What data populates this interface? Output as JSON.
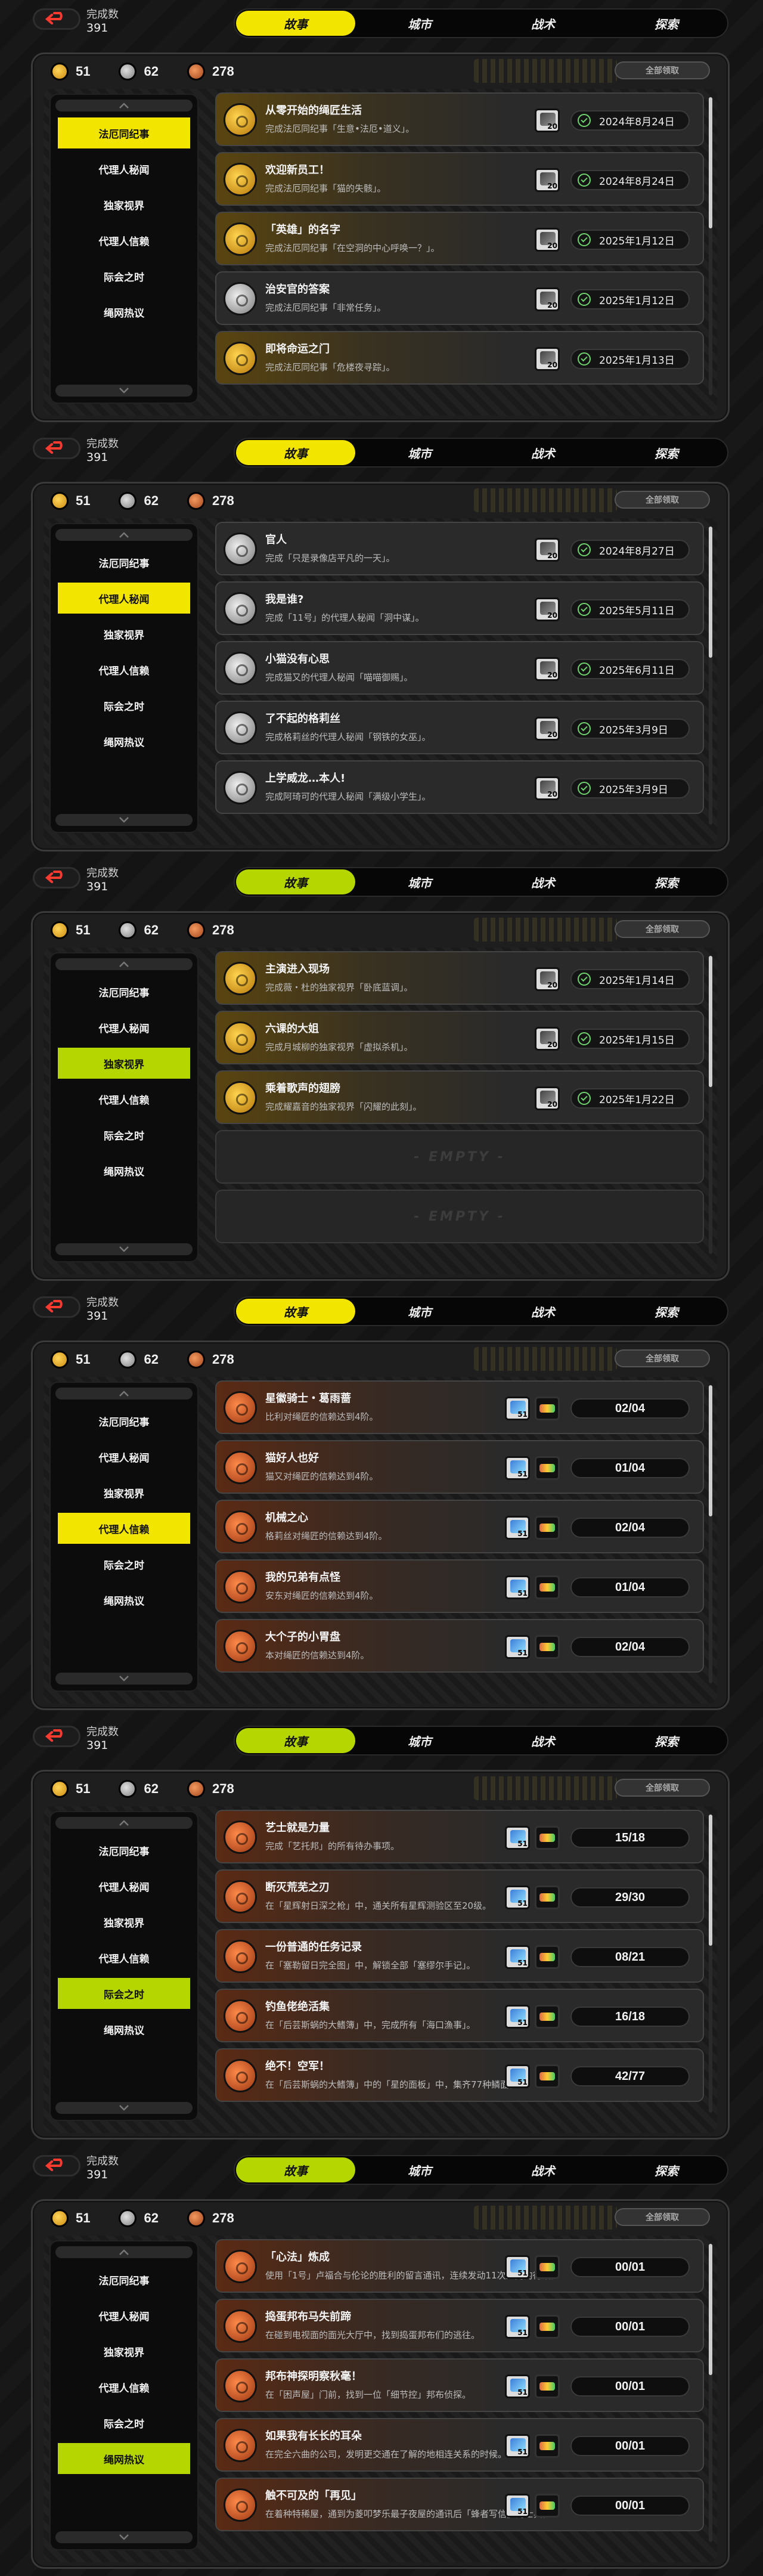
{
  "header": {
    "done_label": "完成数",
    "done_count": "391"
  },
  "tabs": [
    "故事",
    "城市",
    "战术",
    "探索"
  ],
  "currency": {
    "gold": "51",
    "silver": "62",
    "bronze": "278"
  },
  "claim_all": "全部领取",
  "sidebar_items": [
    "法厄同纪事",
    "代理人秘闻",
    "独家视界",
    "代理人信赖",
    "际会之时",
    "绳网热议"
  ],
  "empty_label": "- EMPTY -",
  "colors": {
    "active_yellow": "#f2e500",
    "active_lime": "#b5d600"
  },
  "screens": [
    {
      "active_tab": 0,
      "active_side": 0,
      "accent": "#f2e500",
      "cards": [
        {
          "title": "从零开始的绳匠生活",
          "desc": "完成法厄同纪事「生意•法厄•道义」。",
          "medal": "gold",
          "reward": "20",
          "date": "2024年8月24日"
        },
        {
          "title": "欢迎新员工！",
          "desc": "完成法厄同纪事「猫的失骸」。",
          "medal": "gold",
          "reward": "20",
          "date": "2024年8月24日"
        },
        {
          "title": "「英雄」的名字",
          "desc": "完成法厄同纪事「在空洞的中心呼唤一？」。",
          "medal": "gold",
          "reward": "20",
          "date": "2025年1月12日"
        },
        {
          "title": "治安官的答案",
          "desc": "完成法厄同纪事「非常任务」。",
          "medal": "silver",
          "reward": "20",
          "date": "2025年1月12日"
        },
        {
          "title": "即将命运之门",
          "desc": "完成法厄同纪事「危楼夜寻踪」。",
          "medal": "gold",
          "reward": "20",
          "date": "2025年1月13日"
        }
      ]
    },
    {
      "active_tab": 0,
      "active_side": 1,
      "accent": "#f2e500",
      "cards": [
        {
          "title": "官人",
          "desc": "完成「只是录像店平凡的一天」。",
          "medal": "silver",
          "reward": "20",
          "date": "2024年8月27日"
        },
        {
          "title": "我是谁?",
          "desc": "完成「11号」的代理人秘闻「洞中谋」。",
          "medal": "silver",
          "reward": "20",
          "date": "2025年5月11日"
        },
        {
          "title": "小猫没有心思",
          "desc": "完成猫又的代理人秘闻「喵喵御赐」。",
          "medal": "silver",
          "reward": "20",
          "date": "2025年6月11日"
        },
        {
          "title": "了不起的格莉丝",
          "desc": "完成格莉丝的代理人秘闻「钢铁的女巫」。",
          "medal": "silver",
          "reward": "20",
          "date": "2025年3月9日"
        },
        {
          "title": "上学威龙…本人!",
          "desc": "完成阿琦可的代理人秘闻「满级小学生」。",
          "medal": "silver",
          "reward": "20",
          "date": "2025年3月9日"
        }
      ]
    },
    {
      "active_tab": 0,
      "active_side": 2,
      "accent": "#b5d600",
      "cards": [
        {
          "title": "主演进入现场",
          "desc": "完成薇・杜的独家视界「卧底蓝调」。",
          "medal": "gold",
          "reward": "20",
          "date": "2025年1月14日"
        },
        {
          "title": "六课的大姐",
          "desc": "完成月城柳的独家视界「虚拟杀机」。",
          "medal": "gold",
          "reward": "20",
          "date": "2025年1月15日"
        },
        {
          "title": "乘着歌声的翅膀",
          "desc": "完成耀嘉音的独家视界「闪耀的此刻」。",
          "medal": "gold",
          "reward": "20",
          "date": "2025年1月22日"
        }
      ],
      "empties": 2
    },
    {
      "active_tab": 0,
      "active_side": 3,
      "accent": "#f2e500",
      "cards": [
        {
          "title": "星徽骑士・葛雨蔷",
          "desc": "比利对绳匠的信赖达到4阶。",
          "medal": "bronze",
          "reward": "51",
          "progress": "02/04"
        },
        {
          "title": "猫好人也好",
          "desc": "猫又对绳匠的信赖达到4阶。",
          "medal": "bronze",
          "reward": "51",
          "progress": "01/04"
        },
        {
          "title": "机械之心",
          "desc": "格莉丝对绳匠的信赖达到4阶。",
          "medal": "bronze",
          "reward": "51",
          "progress": "02/04"
        },
        {
          "title": "我的兄弟有点怪",
          "desc": "安东对绳匠的信赖达到4阶。",
          "medal": "bronze",
          "reward": "51",
          "progress": "01/04"
        },
        {
          "title": "大个子的小胃盘",
          "desc": "本对绳匠的信赖达到4阶。",
          "medal": "bronze",
          "reward": "51",
          "progress": "02/04"
        }
      ]
    },
    {
      "active_tab": 0,
      "active_side": 4,
      "accent": "#b5d600",
      "cards": [
        {
          "title": "艺士就是力量",
          "desc": "完成「艺托邦」的所有待办事项。",
          "medal": "bronze",
          "reward": "51",
          "progress": "15/18"
        },
        {
          "title": "断灭荒芜之刃",
          "desc": "在「星辉射日深之枪」中，通关所有星辉测验区至20级。",
          "medal": "bronze",
          "reward": "51",
          "progress": "29/30"
        },
        {
          "title": "一份普通的任务记录",
          "desc": "在「塞勒留日完全图」中，解锁全部「塞缪尔手记」。",
          "medal": "bronze",
          "reward": "51",
          "progress": "08/21"
        },
        {
          "title": "钓鱼佬绝活集",
          "desc": "在「后芸斯蜗的大鳍簿」中，完成所有「海口漁事」。",
          "medal": "bronze",
          "reward": "51",
          "progress": "16/18"
        },
        {
          "title": "绝不！空军！",
          "desc": "在「后芸斯蜗的大鳍簿」中的「星的面板」中，集齐77种鳞面。",
          "medal": "bronze",
          "reward": "51",
          "progress": "42/77"
        }
      ]
    },
    {
      "active_tab": 0,
      "active_side": 5,
      "accent": "#b5d600",
      "cards": [
        {
          "title": "「心法」炼成",
          "desc": "使用「1号」卢福合与伦论的胜利的留言通讯，连续发动11次上门的得效。",
          "medal": "bronze",
          "reward": "51",
          "progress": "00/01"
        },
        {
          "title": "捣蛋邦布马失前蹄",
          "desc": "在碰到电视面的面光大厅中，找到捣蛋邦布们的逃往。",
          "medal": "bronze",
          "reward": "51",
          "progress": "00/01"
        },
        {
          "title": "邦布神探明察秋毫！",
          "desc": "在「困声屋」门前，找到一位「细节控」邦布侦探。",
          "medal": "bronze",
          "reward": "51",
          "progress": "00/01"
        },
        {
          "title": "如果我有长长的耳朵",
          "desc": "在完全六曲的公司，发明更交通在了解的地相连关系的时候。",
          "medal": "bronze",
          "reward": "51",
          "progress": "00/01"
        },
        {
          "title": "触不可及的「再见」",
          "desc": "在着种特稀屋，通到为菱叩梦乐最子夜屋的通讯后「蜂者写信」的士兵。",
          "medal": "bronze",
          "reward": "51",
          "progress": "00/01"
        }
      ]
    }
  ]
}
